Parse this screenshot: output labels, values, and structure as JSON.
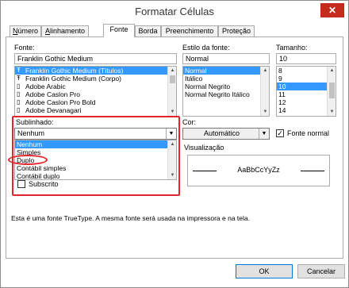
{
  "window": {
    "title": "Formatar Células",
    "close_glyph": "✕"
  },
  "tabs": [
    {
      "label": "Número",
      "accel_pre": "",
      "accel": "N",
      "accel_post": "úmero"
    },
    {
      "label": "Alinhamento",
      "accel_pre": "",
      "accel": "A",
      "accel_post": "linhamento"
    },
    {
      "label": "Fonte",
      "active": true
    },
    {
      "label": "Borda"
    },
    {
      "label": "Preenchimento"
    },
    {
      "label": "Proteção"
    }
  ],
  "font": {
    "label": "Fonte:",
    "value": "Franklin Gothic Medium",
    "items": [
      {
        "icon": "truetype-icon",
        "glyph": "Ŧ",
        "text": "Franklin Gothic Medium (Títulos)",
        "selected": true
      },
      {
        "icon": "truetype-icon",
        "glyph": "Ŧ",
        "text": "Franklin Gothic Medium (Corpo)"
      },
      {
        "icon": "opentype-icon",
        "glyph": "▯",
        "text": "Adobe Arabic"
      },
      {
        "icon": "opentype-icon",
        "glyph": "▯",
        "text": "Adobe Caslon Pro"
      },
      {
        "icon": "opentype-icon",
        "glyph": "▯",
        "text": "Adobe Caslon Pro Bold"
      },
      {
        "icon": "opentype-icon",
        "glyph": "▯",
        "text": "Adobe Devanagari"
      }
    ]
  },
  "style": {
    "label": "Estilo da fonte:",
    "value": "Normal",
    "items": [
      {
        "text": "Normal",
        "selected": true
      },
      {
        "text": "Itálico"
      },
      {
        "text": "Normal Negrito"
      },
      {
        "text": "Normal Negrito Itálico"
      }
    ]
  },
  "size": {
    "label": "Tamanho:",
    "value": "10",
    "items": [
      {
        "text": "8"
      },
      {
        "text": "9"
      },
      {
        "text": "10",
        "selected": true
      },
      {
        "text": "11"
      },
      {
        "text": "12"
      },
      {
        "text": "14"
      }
    ]
  },
  "underline": {
    "label": "Sublinhado:",
    "value": "Nenhum",
    "options": [
      {
        "text": "Nenhum",
        "selected": true
      },
      {
        "text": "Simples"
      },
      {
        "text": "Duplo"
      },
      {
        "text": "Contábil simples"
      },
      {
        "text": "Contábil duplo"
      }
    ]
  },
  "color": {
    "label": "Cor:",
    "value": "Automático",
    "normal_font_label": "Fonte normal",
    "normal_font_checked": true
  },
  "effects": {
    "subscript_label": "Subscrito"
  },
  "preview": {
    "label": "Visualização",
    "sample": "AaBbCcYyZz"
  },
  "info": "Esta é uma fonte TrueType. A mesma fonte será usada na impressora e na tela.",
  "buttons": {
    "ok": "OK",
    "cancel": "Cancelar"
  },
  "colors": {
    "selection": "#3399ff",
    "highlight": "#e3262d",
    "close": "#c42b1c"
  }
}
